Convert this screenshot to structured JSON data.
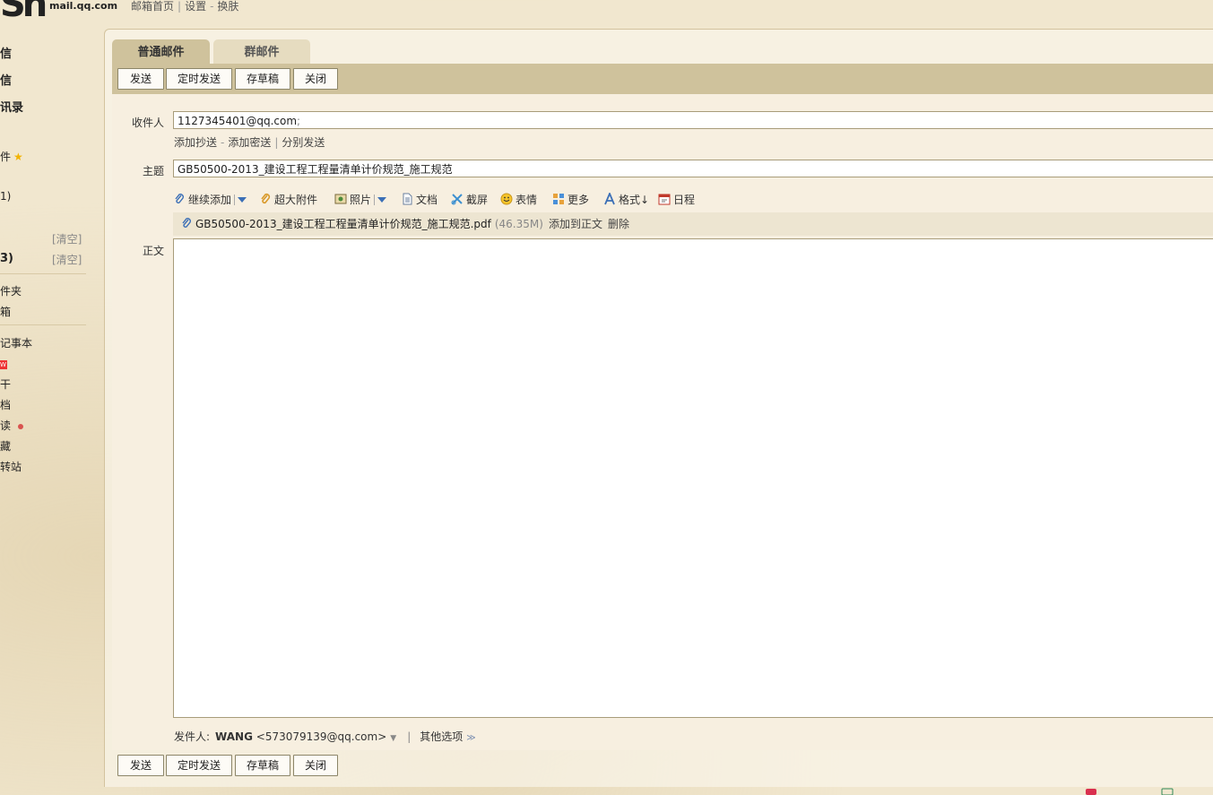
{
  "brand": {
    "logo_text": "Sn",
    "domain": "mail.qq.com"
  },
  "top_links": {
    "home": "邮箱首页",
    "settings": "设置",
    "skin": "换肤"
  },
  "nav": {
    "items": [
      {
        "label": "信",
        "bold": true
      },
      {
        "label": "信",
        "bold": true
      },
      {
        "label": "讯录",
        "bold": true
      },
      {
        "label": "件"
      },
      {
        "label": "1)"
      },
      {
        "label": "3)",
        "bold": true
      },
      {
        "label": "件夹"
      },
      {
        "label": "箱"
      },
      {
        "label": "记事本"
      },
      {
        "label": "W"
      },
      {
        "label": "干"
      },
      {
        "label": "档"
      },
      {
        "label": "读"
      },
      {
        "label": "藏"
      },
      {
        "label": "转站"
      }
    ],
    "clear_label": "[清空]"
  },
  "tabs": {
    "normal": "普通邮件",
    "group": "群邮件"
  },
  "toolbar": {
    "send": "发送",
    "timed_send": "定时发送",
    "save_draft": "存草稿",
    "close": "关闭"
  },
  "compose": {
    "recipient_label": "收件人",
    "recipient_value": "1127345401@qq.com",
    "recipient_sep": ";",
    "add_cc": "添加抄送",
    "add_bcc": "添加密送",
    "separate_send": "分别发送",
    "subject_label": "主题",
    "subject_value": "GB50500-2013_建设工程工程量清单计价规范_施工规范",
    "body_label": "正文"
  },
  "tools": {
    "continue_add": "继续添加",
    "large_attach": "超大附件",
    "photo": "照片",
    "document": "文档",
    "screenshot": "截屏",
    "emoji": "表情",
    "more": "更多",
    "format": "格式↓",
    "schedule": "日程"
  },
  "attachment": {
    "name": "GB50500-2013_建设工程工程量清单计价规范_施工规范.pdf",
    "size": "(46.35M)",
    "add_to_body": "添加到正文",
    "delete": "删除"
  },
  "sender": {
    "label": "发件人:",
    "name": "WANG",
    "email": "<573079139@qq.com>",
    "other_options": "其他选项"
  },
  "colors": {
    "toolbar_bg": "#cfc29c",
    "page_bg": "#f1e7cf",
    "compose_bg": "#f7efe0"
  }
}
